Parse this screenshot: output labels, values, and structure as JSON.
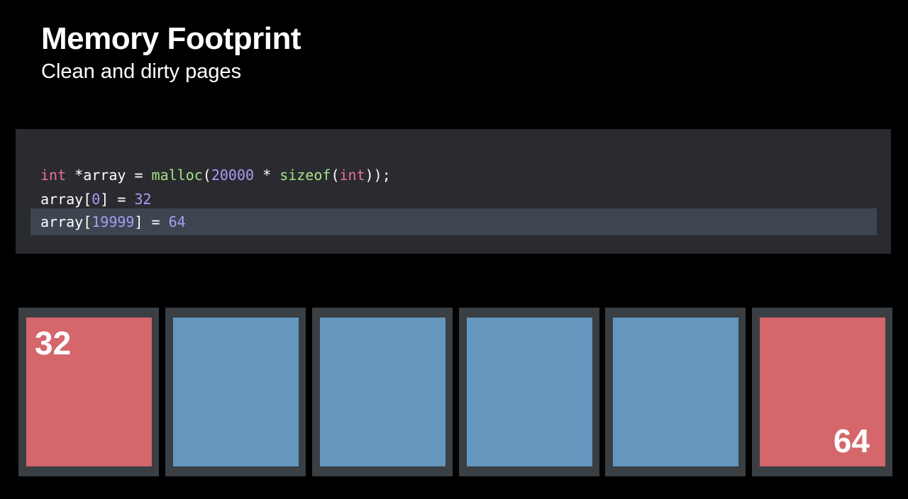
{
  "header": {
    "title": "Memory Footprint",
    "subtitle": "Clean and dirty pages"
  },
  "code": {
    "line1": {
      "type_kw": "int",
      "var": " *array = ",
      "func": "malloc",
      "paren_open": "(",
      "count": "20000",
      "mult": " * ",
      "sizeof_fn": "sizeof",
      "paren_open2": "(",
      "inner_kw": "int",
      "close": "));"
    },
    "line2": {
      "prefix": "array[",
      "index": "0",
      "mid": "] = ",
      "value": "32"
    },
    "line3": {
      "prefix": "array[",
      "index": "19999",
      "mid": "] = ",
      "value": "64"
    },
    "highlighted_line": 3
  },
  "pages": [
    {
      "state": "dirty",
      "color": "#d4666c",
      "label": "32",
      "label_position": "top-left"
    },
    {
      "state": "clean",
      "color": "#6596bd",
      "label": ""
    },
    {
      "state": "clean",
      "color": "#6596bd",
      "label": ""
    },
    {
      "state": "clean",
      "color": "#6596bd",
      "label": ""
    },
    {
      "state": "clean",
      "color": "#6596bd",
      "label": ""
    },
    {
      "state": "dirty",
      "color": "#d4666c",
      "label": "64",
      "label_position": "bottom-right"
    }
  ],
  "colors": {
    "background": "#000000",
    "code_panel": "#2a2b30",
    "highlight_line": "#3d4650",
    "page_frame": "#3a3f44",
    "keyword": "#f06e9c",
    "function": "#a8e085",
    "number": "#a89cf2",
    "dirty_page": "#d4666c",
    "clean_page": "#6596bd"
  }
}
